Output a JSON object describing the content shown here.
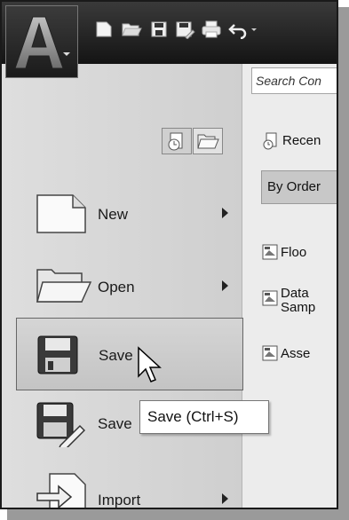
{
  "app": {
    "logo_letter": "A"
  },
  "quick_access": [
    "new-icon",
    "open-icon",
    "save-icon",
    "saveas-icon",
    "print-icon",
    "undo-icon"
  ],
  "search": {
    "placeholder": "Search Con"
  },
  "view_toggle": [
    "recent-documents-icon",
    "open-documents-icon"
  ],
  "menu": {
    "items": [
      {
        "label": "New",
        "has_submenu": true
      },
      {
        "label": "Open",
        "has_submenu": true
      },
      {
        "label": "Save",
        "has_submenu": false,
        "selected": true
      },
      {
        "label": "Save",
        "has_submenu": false
      },
      {
        "label": "Import",
        "has_submenu": true
      }
    ]
  },
  "right_panel": {
    "header": "Recen",
    "order_dropdown": "By Order",
    "files": [
      {
        "line1": "Floo",
        "line2": ""
      },
      {
        "line1": "Data",
        "line2": "Samp"
      },
      {
        "line1": "Asse",
        "line2": ""
      }
    ]
  },
  "tooltip": {
    "text": "Save (Ctrl+S)"
  }
}
